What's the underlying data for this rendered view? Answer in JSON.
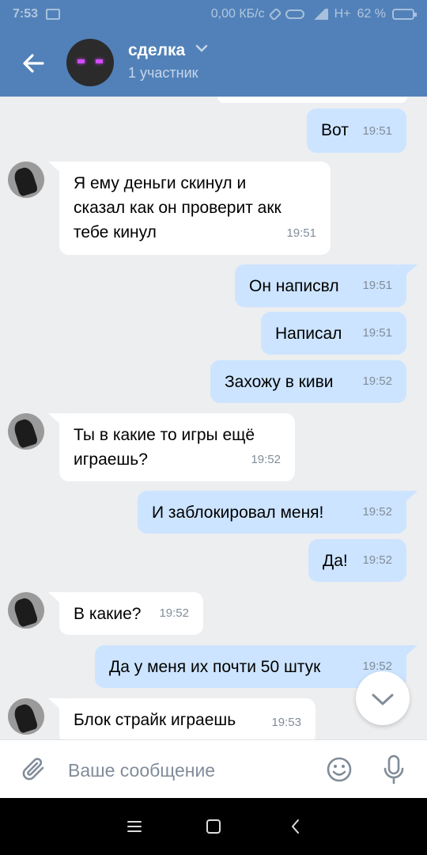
{
  "status_bar": {
    "time": "7:53",
    "network_speed": "0,00 КБ/с",
    "network_type": "H+",
    "battery": "62 %"
  },
  "header": {
    "title": "сделка",
    "subtitle": "1 участник"
  },
  "messages": [
    {
      "dir": "out",
      "text": "Вот",
      "time": "19:51"
    },
    {
      "dir": "in",
      "text": "Я ему деньги скинул и\nсказал как он проверит акк\nтебе кинул",
      "time": "19:51"
    },
    {
      "dir": "out",
      "text": "Он написвл",
      "time": "19:51"
    },
    {
      "dir": "out",
      "text": "Написал",
      "time": "19:51"
    },
    {
      "dir": "out",
      "text": "Захожу в киви",
      "time": "19:52"
    },
    {
      "dir": "in",
      "text": "Ты в какие то игры ещё\nиграешь?",
      "time": "19:52"
    },
    {
      "dir": "out",
      "text": "И заблокировал меня!",
      "time": "19:52"
    },
    {
      "dir": "out",
      "text": "Да!",
      "time": "19:52"
    },
    {
      "dir": "in",
      "text": "В какие?",
      "time": "19:52"
    },
    {
      "dir": "out",
      "text": "Да у меня их почти 50 штук",
      "time": "19:52"
    },
    {
      "dir": "in",
      "text": "Блок страйк играешь",
      "time": "19:53"
    }
  ],
  "composer": {
    "placeholder": "Ваше сообщение"
  },
  "colors": {
    "header_bg": "#5181b8",
    "chat_bg": "#edeef0",
    "bubble_out": "#cce4ff",
    "bubble_in": "#ffffff",
    "time_text": "#818c99"
  },
  "icons": [
    "back-arrow-icon",
    "chevron-down-icon",
    "paperclip-icon",
    "smile-icon",
    "microphone-icon",
    "chevron-down-icon",
    "menu-icon",
    "home-icon",
    "back-icon"
  ]
}
